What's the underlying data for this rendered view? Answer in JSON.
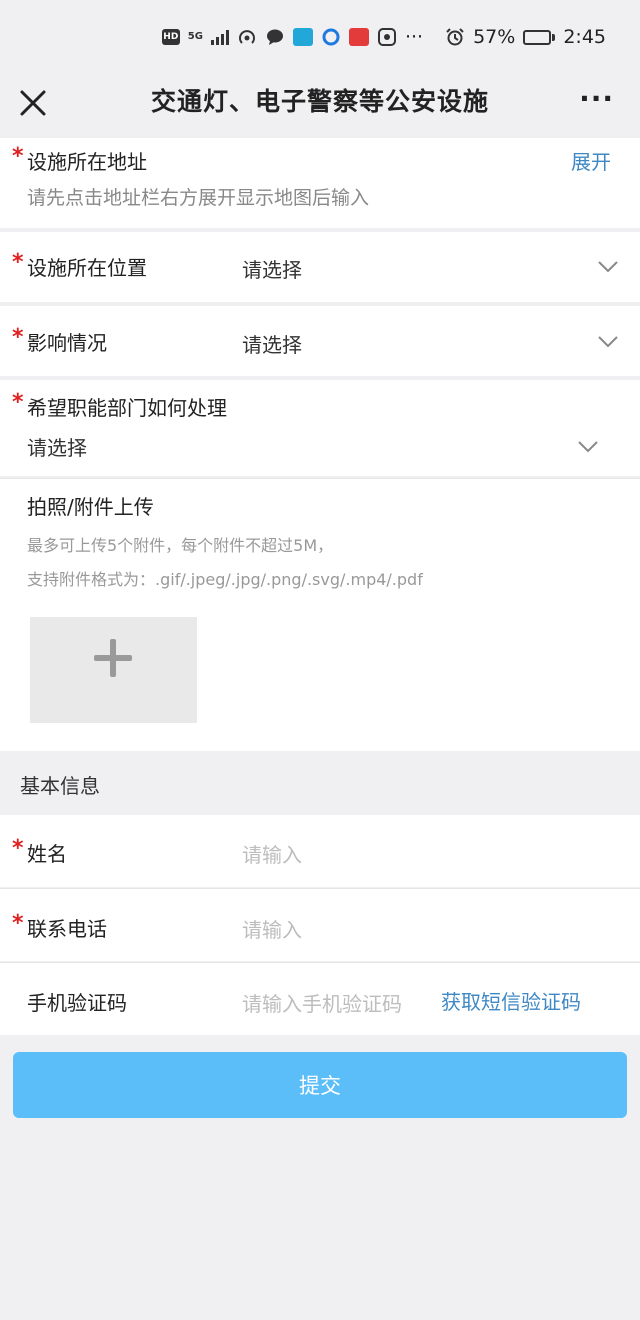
{
  "status_bar": {
    "hd": "HD",
    "signal": "5G",
    "battery": "57%",
    "battery_level": 0.57,
    "time": "2:45",
    "dots": "···",
    "icons": [
      "hotspot-icon",
      "message-icon",
      "app-icon",
      "app-icon",
      "app-icon",
      "app-icon",
      "alarm-icon",
      "battery-icon"
    ]
  },
  "nav": {
    "title": "交通灯、电子警察等公安设施",
    "more": "···"
  },
  "form": {
    "address": {
      "required_mark": "*",
      "label": "设施所在地址",
      "expand": "展开",
      "hint": "请先点击地址栏右方展开显示地图后输入"
    },
    "position": {
      "required_mark": "*",
      "label": "设施所在位置",
      "value": "请选择"
    },
    "impact": {
      "required_mark": "*",
      "label": "影响情况",
      "value": "请选择"
    },
    "handling": {
      "required_mark": "*",
      "label": "希望职能部门如何处理",
      "value": "请选择"
    },
    "upload": {
      "label": "拍照/附件上传",
      "hint1": "最多可上传5个附件，每个附件不超过5M，",
      "hint2": "支持附件格式为：.gif/.jpeg/.jpg/.png/.svg/.mp4/.pdf"
    }
  },
  "basic_info": {
    "title": "基本信息",
    "name": {
      "required_mark": "*",
      "label": "姓名",
      "placeholder": "请输入"
    },
    "phone": {
      "required_mark": "*",
      "label": "联系电话",
      "placeholder": "请输入"
    },
    "code": {
      "label": "手机验证码",
      "placeholder": "请输入手机验证码",
      "get_code": "获取短信验证码"
    }
  },
  "submit": "提交"
}
